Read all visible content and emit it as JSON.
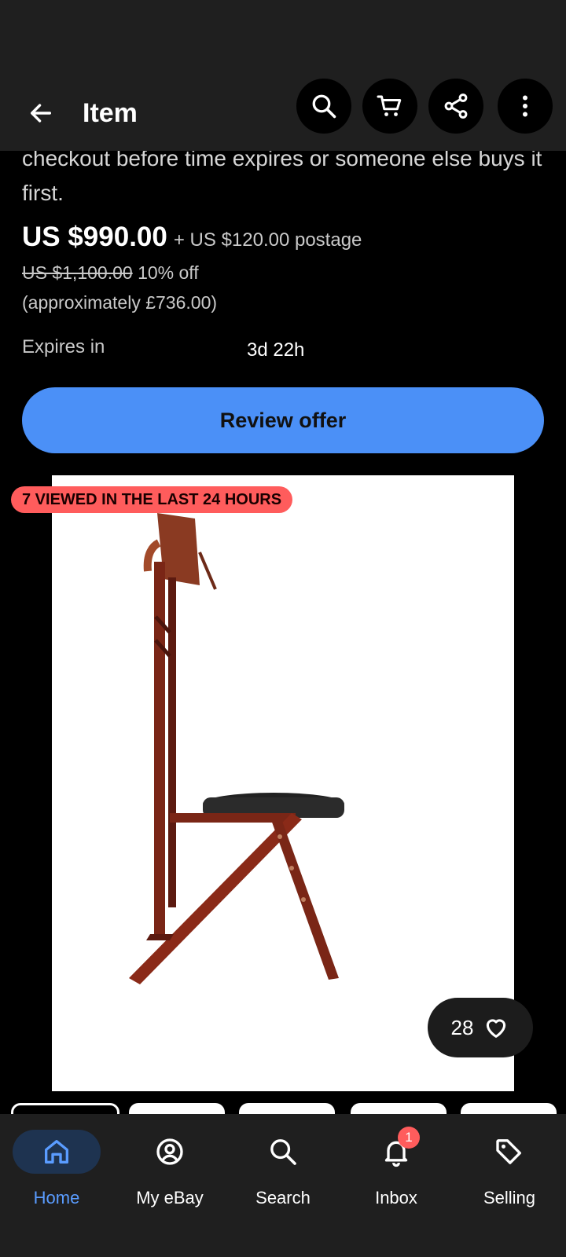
{
  "appbar": {
    "title": "Item"
  },
  "offer": {
    "expiry_text_partial": "checkout before time expires or someone else buys it first.",
    "price": "US $990.00",
    "postage": "+ US $120.00 postage",
    "was_price": "US $1,100.00",
    "discount": "10% off",
    "approx": "(approximately £736.00)",
    "expires_label": "Expires in",
    "expires_value": "3d 22h",
    "review_button": "Review offer"
  },
  "gallery": {
    "badge": "7 VIEWED IN THE LAST 24 HOURS",
    "likes": "28",
    "image_description": "wooden folding valet chair with black seat"
  },
  "nav": {
    "items": [
      {
        "label": "Home",
        "icon": "home-icon",
        "active": true
      },
      {
        "label": "My eBay",
        "icon": "user-icon"
      },
      {
        "label": "Search",
        "icon": "search-icon"
      },
      {
        "label": "Inbox",
        "icon": "bell-icon",
        "badge": "1"
      },
      {
        "label": "Selling",
        "icon": "tag-icon"
      }
    ]
  },
  "colors": {
    "accent": "#4b90f7",
    "badge": "#ff5c5c",
    "bar": "#1f1f1f"
  }
}
